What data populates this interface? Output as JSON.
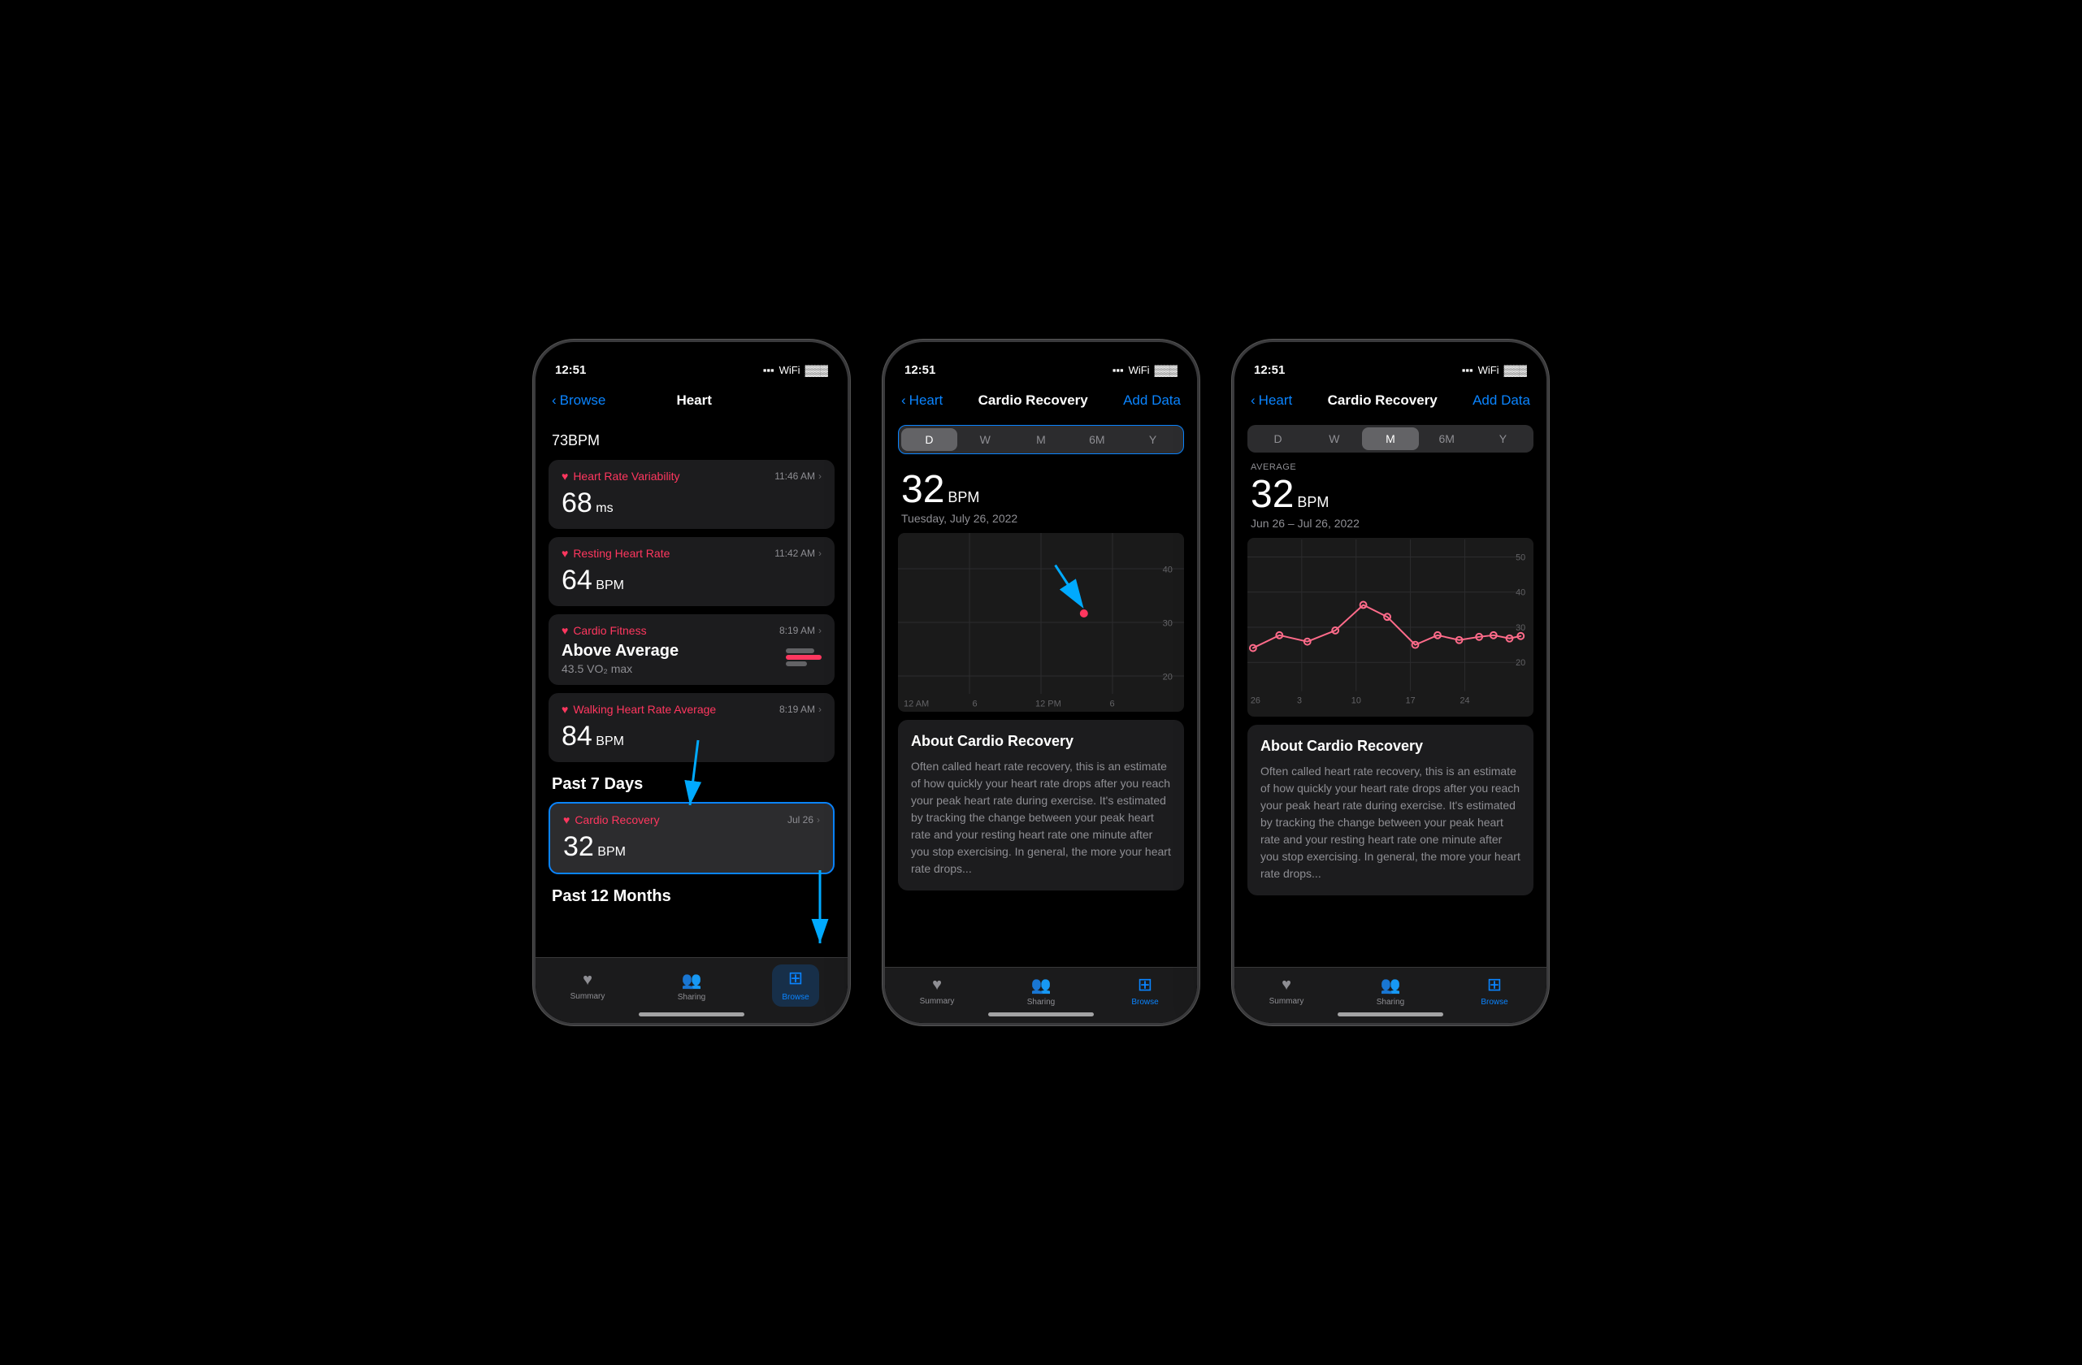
{
  "phones": [
    {
      "id": "phone1",
      "status_time": "12:51",
      "nav": {
        "back_label": "Browse",
        "title": "Heart",
        "action": null
      },
      "content_type": "heart_list",
      "top_value": "73",
      "top_unit": "BPM",
      "cards": [
        {
          "title": "Heart Rate Variability",
          "time": "11:46 AM",
          "value": "68",
          "unit": "ms",
          "highlighted": false
        },
        {
          "title": "Resting Heart Rate",
          "time": "11:42 AM",
          "value": "64",
          "unit": "BPM",
          "highlighted": false
        },
        {
          "title": "Cardio Fitness",
          "time": "8:19 AM",
          "value": "Above Average",
          "sub": "43.5 VO₂ max",
          "highlighted": false
        },
        {
          "title": "Walking Heart Rate Average",
          "time": "8:19 AM",
          "value": "84",
          "unit": "BPM",
          "highlighted": false
        }
      ],
      "section_past7": "Past 7 Days",
      "cardio_recovery": {
        "title": "Cardio Recovery",
        "date": "Jul 26",
        "value": "32",
        "unit": "BPM",
        "highlighted": true
      },
      "section_past12": "Past 12 Months",
      "tabs": [
        {
          "label": "Summary",
          "icon": "♥",
          "active": false
        },
        {
          "label": "Sharing",
          "icon": "👥",
          "active": false
        },
        {
          "label": "Browse",
          "icon": "⊞",
          "active": true
        }
      ]
    },
    {
      "id": "phone2",
      "status_time": "12:51",
      "nav": {
        "back_label": "Heart",
        "title": "Cardio Recovery",
        "action": "Add Data"
      },
      "content_type": "cardio_detail_day",
      "period_tabs": [
        "D",
        "W",
        "M",
        "6M",
        "Y"
      ],
      "active_period": "D",
      "metric_value": "32",
      "metric_unit": "BPM",
      "metric_date": "Tuesday, July 26, 2022",
      "chart": {
        "x_labels": [
          "12 AM",
          "6",
          "12 PM",
          "6"
        ],
        "y_labels": [
          "40",
          "30",
          "20"
        ],
        "data_point": {
          "x": 0.65,
          "y": 0.45
        }
      },
      "about_title": "About Cardio Recovery",
      "about_text": "Often called heart rate recovery, this is an estimate of how quickly your heart rate drops after you reach your peak heart rate during exercise. It's estimated by tracking the change between your peak heart rate and your resting heart rate one minute after you stop exercising. In general, the more your heart rate drops...",
      "tabs": [
        {
          "label": "Summary",
          "icon": "♥",
          "active": false
        },
        {
          "label": "Sharing",
          "icon": "👥",
          "active": false
        },
        {
          "label": "Browse",
          "icon": "⊞",
          "active": true
        }
      ]
    },
    {
      "id": "phone3",
      "status_time": "12:51",
      "nav": {
        "back_label": "Heart",
        "title": "Cardio Recovery",
        "action": "Add Data"
      },
      "content_type": "cardio_detail_month",
      "period_tabs": [
        "D",
        "W",
        "M",
        "6M",
        "Y"
      ],
      "active_period": "M",
      "average_label": "AVERAGE",
      "metric_value": "32",
      "metric_unit": "BPM",
      "metric_date": "Jun 26 – Jul 26, 2022",
      "chart": {
        "x_labels": [
          "26",
          "3",
          "10",
          "17",
          "24"
        ],
        "y_labels": [
          "50",
          "40",
          "30",
          "20"
        ],
        "line_data": [
          {
            "x": 0.02,
            "y": 0.62
          },
          {
            "x": 0.12,
            "y": 0.55
          },
          {
            "x": 0.22,
            "y": 0.58
          },
          {
            "x": 0.32,
            "y": 0.52
          },
          {
            "x": 0.42,
            "y": 0.38
          },
          {
            "x": 0.52,
            "y": 0.45
          },
          {
            "x": 0.62,
            "y": 0.6
          },
          {
            "x": 0.7,
            "y": 0.55
          },
          {
            "x": 0.78,
            "y": 0.58
          },
          {
            "x": 0.85,
            "y": 0.56
          },
          {
            "x": 0.9,
            "y": 0.55
          },
          {
            "x": 0.95,
            "y": 0.57
          },
          {
            "x": 0.98,
            "y": 0.55
          }
        ]
      },
      "about_title": "About Cardio Recovery",
      "about_text": "Often called heart rate recovery, this is an estimate of how quickly your heart rate drops after you reach your peak heart rate during exercise. It's estimated by tracking the change between your peak heart rate and your resting heart rate one minute after you stop exercising. In general, the more your heart rate drops...",
      "tabs": [
        {
          "label": "Summary",
          "icon": "♥",
          "active": false
        },
        {
          "label": "Sharing",
          "icon": "👥",
          "active": false
        },
        {
          "label": "Browse",
          "icon": "⊞",
          "active": true
        }
      ]
    }
  ],
  "colors": {
    "accent_blue": "#0a84ff",
    "accent_red": "#ff375f",
    "bg_dark": "#000",
    "bg_card": "#1c1c1e",
    "bg_card2": "#2c2c2e",
    "text_primary": "#fff",
    "text_secondary": "#8e8e93"
  }
}
